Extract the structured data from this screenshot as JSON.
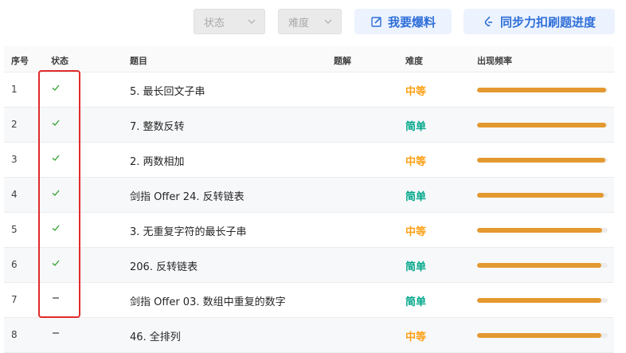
{
  "filters": {
    "status_label": "状态",
    "difficulty_label": "难度"
  },
  "buttons": {
    "report_label": "我要爆料",
    "sync_label": "同步力扣刷题进度"
  },
  "table": {
    "headers": {
      "index": "序号",
      "status": "状态",
      "title": "题目",
      "solution": "题解",
      "difficulty": "难度",
      "frequency": "出现频率"
    },
    "rows": [
      {
        "index": "1",
        "status": "solved",
        "title": "5. 最长回文子串",
        "difficulty": "中等",
        "level": "mid",
        "frequency": 0.99
      },
      {
        "index": "2",
        "status": "solved",
        "title": "7. 整数反转",
        "difficulty": "简单",
        "level": "easy",
        "frequency": 0.99
      },
      {
        "index": "3",
        "status": "solved",
        "title": "2. 两数相加",
        "difficulty": "中等",
        "level": "mid",
        "frequency": 0.98
      },
      {
        "index": "4",
        "status": "solved",
        "title": "剑指 Offer 24. 反转链表",
        "difficulty": "简单",
        "level": "easy",
        "frequency": 0.97
      },
      {
        "index": "5",
        "status": "solved",
        "title": "3. 无重复字符的最长子串",
        "difficulty": "中等",
        "level": "mid",
        "frequency": 0.96
      },
      {
        "index": "6",
        "status": "solved",
        "title": "206. 反转链表",
        "difficulty": "简单",
        "level": "easy",
        "frequency": 0.95
      },
      {
        "index": "7",
        "status": "unsolved",
        "title": "剑指 Offer 03. 数组中重复的数字",
        "difficulty": "简单",
        "level": "easy",
        "frequency": 0.95
      },
      {
        "index": "8",
        "status": "unsolved",
        "title": "46. 全排列",
        "difficulty": "中等",
        "level": "mid",
        "frequency": 0.95
      }
    ]
  },
  "colors": {
    "medium": "#ffa116",
    "easy": "#00a68a",
    "bar": "#e3992f",
    "check": "#2ca02c",
    "highlight": "#e12b2b",
    "accent": "#2f6fd9"
  }
}
